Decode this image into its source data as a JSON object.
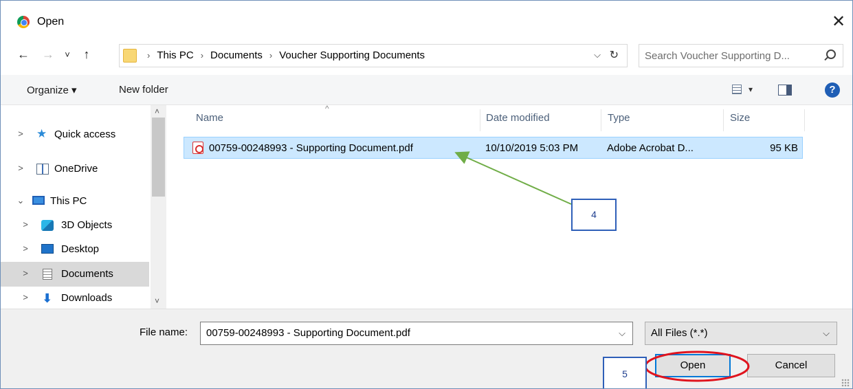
{
  "window": {
    "title": "Open",
    "close_glyph": "✕"
  },
  "nav_buttons": {
    "back": "←",
    "forward": "→",
    "recent": "˅",
    "up": "↑"
  },
  "address": {
    "crumbs": [
      "This PC",
      "Documents",
      "Voucher Supporting Documents"
    ],
    "separator": "›",
    "chevron": "⌵",
    "refresh": "↻"
  },
  "search": {
    "placeholder": "Search Voucher Supporting D..."
  },
  "toolbar": {
    "organize": "Organize ▾",
    "new_folder": "New folder",
    "view_chevron": "▾",
    "help": "?"
  },
  "nav_pane": {
    "items": [
      {
        "label": "Quick access",
        "expander": ">",
        "icon": "star-icon"
      },
      {
        "label": "OneDrive",
        "expander": ">",
        "icon": "onedrive-icon"
      },
      {
        "label": "This PC",
        "expander": "⌄",
        "icon": "pc-icon"
      },
      {
        "label": "3D Objects",
        "expander": ">",
        "icon": "3d-objects-icon"
      },
      {
        "label": "Desktop",
        "expander": ">",
        "icon": "desktop-icon"
      },
      {
        "label": "Documents",
        "expander": ">",
        "icon": "documents-icon",
        "selected": true
      },
      {
        "label": "Downloads",
        "expander": ">",
        "icon": "downloads-icon"
      }
    ],
    "scroll_up": "˄",
    "scroll_down": "˅"
  },
  "file_list": {
    "columns": {
      "name": "Name",
      "date": "Date modified",
      "type": "Type",
      "size": "Size"
    },
    "sort_caret": "^",
    "rows": [
      {
        "name": "00759-00248993 - Supporting Document.pdf",
        "date": "10/10/2019 5:03 PM",
        "type": "Adobe Acrobat D...",
        "size": "95 KB"
      }
    ]
  },
  "bottom": {
    "file_name_label": "File name:",
    "file_name_value": "00759-00248993 - Supporting Document.pdf",
    "filter_value": "All Files (*.*)",
    "chevron": "⌵",
    "open_label": "Open",
    "cancel_label": "Cancel"
  },
  "annotations": {
    "step_four": "4",
    "step_five": "5",
    "arrow_color": "#70ad47",
    "box_color": "#2e5fb8",
    "ellipse_color": "#e0141e"
  }
}
